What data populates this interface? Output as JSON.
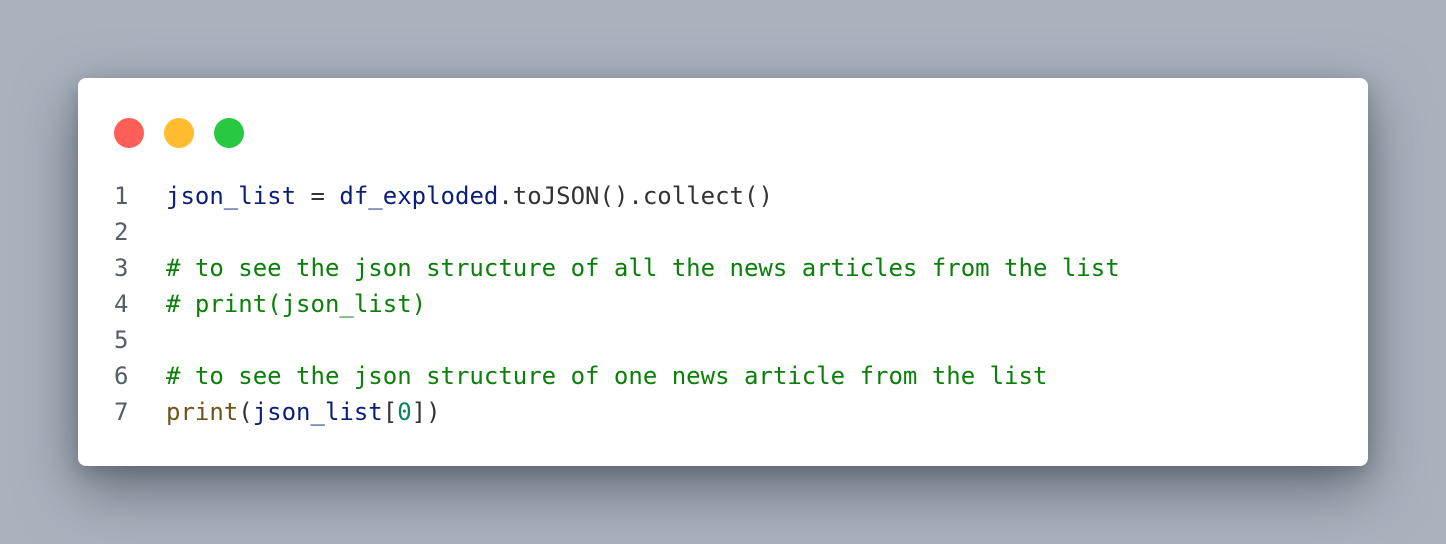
{
  "window": {
    "controls": [
      {
        "name": "close",
        "color": "#ff5f57"
      },
      {
        "name": "minimize",
        "color": "#febc2e"
      },
      {
        "name": "maximize",
        "color": "#28c840"
      }
    ]
  },
  "colors": {
    "identifier": "#0b1f7a",
    "default": "#333333",
    "comment": "#0a7f0a",
    "builtin": "#6b5519",
    "number": "#098658",
    "line_number": "#555d66"
  },
  "code": {
    "lines": [
      {
        "number": "1",
        "tokens": [
          {
            "text": "json_list",
            "kind": "identifier"
          },
          {
            "text": " = ",
            "kind": "default"
          },
          {
            "text": "df_exploded",
            "kind": "identifier"
          },
          {
            "text": ".toJSON().collect()",
            "kind": "default"
          }
        ]
      },
      {
        "number": "2",
        "tokens": []
      },
      {
        "number": "3",
        "tokens": [
          {
            "text": "# to see the json structure of all the news articles from the list",
            "kind": "comment"
          }
        ]
      },
      {
        "number": "4",
        "tokens": [
          {
            "text": "# print(json_list)",
            "kind": "comment"
          }
        ]
      },
      {
        "number": "5",
        "tokens": []
      },
      {
        "number": "6",
        "tokens": [
          {
            "text": "# to see the json structure of one news article from the list",
            "kind": "comment"
          }
        ]
      },
      {
        "number": "7",
        "tokens": [
          {
            "text": "print",
            "kind": "builtin"
          },
          {
            "text": "(",
            "kind": "default"
          },
          {
            "text": "json_list",
            "kind": "identifier"
          },
          {
            "text": "[",
            "kind": "default"
          },
          {
            "text": "0",
            "kind": "number"
          },
          {
            "text": "])",
            "kind": "default"
          }
        ]
      }
    ]
  }
}
